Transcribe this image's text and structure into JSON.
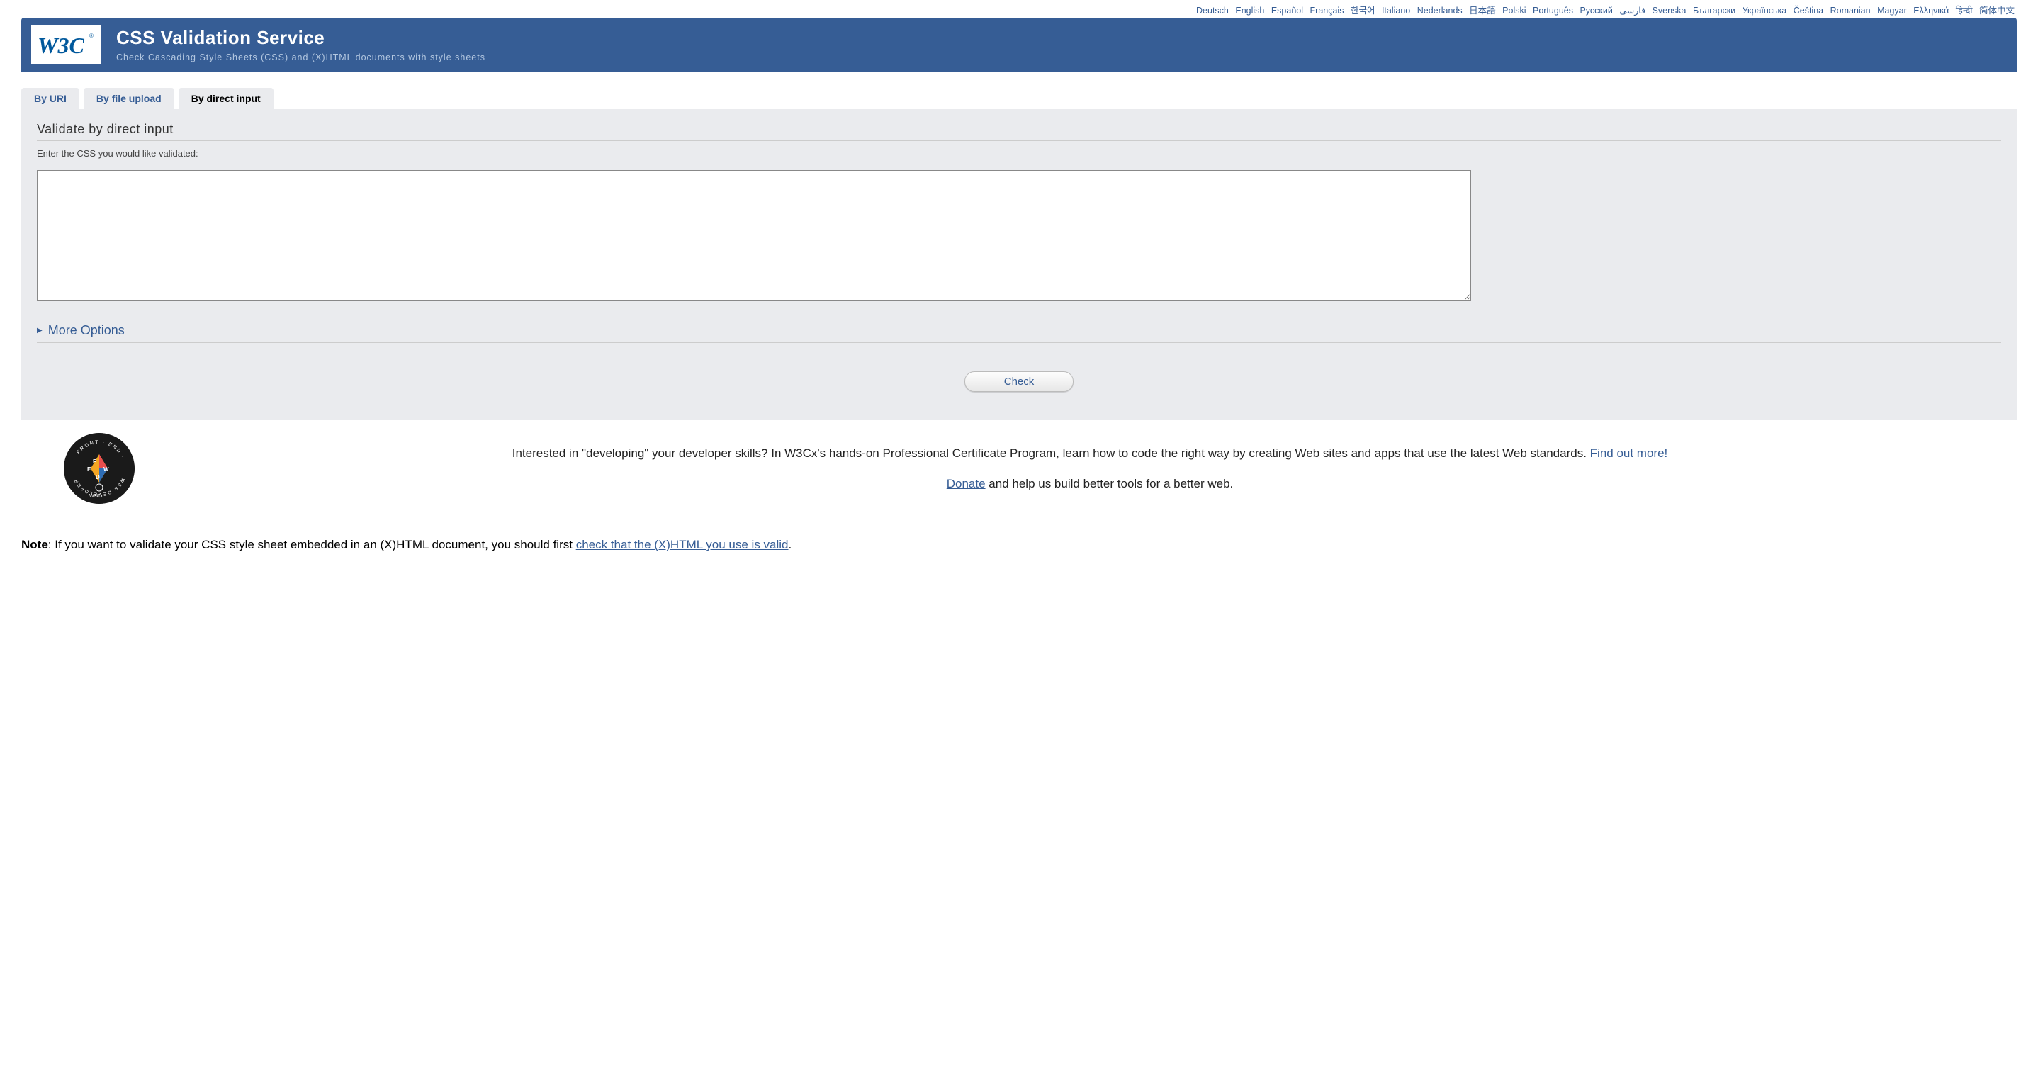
{
  "languages": [
    "Deutsch",
    "English",
    "Español",
    "Français",
    "한국어",
    "Italiano",
    "Nederlands",
    "日本語",
    "Polski",
    "Português",
    "Русский",
    "فارسی",
    "Svenska",
    "Български",
    "Українська",
    "Čeština",
    "Romanian",
    "Magyar",
    "Ελληνικά",
    "हिन्दी",
    "简体中文"
  ],
  "banner": {
    "title": "CSS Validation Service",
    "subtitle": "Check Cascading Style Sheets (CSS) and (X)HTML documents with style sheets",
    "logo_text": "W3C"
  },
  "tabs": {
    "by_uri": "By URI",
    "by_file": "By file upload",
    "by_direct": "By direct input"
  },
  "form": {
    "heading": "Validate by direct input",
    "instruction": "Enter the CSS you would like validated:",
    "textarea_value": "",
    "more_options": "More Options",
    "submit": "Check"
  },
  "promo": {
    "text_before": "Interested in \"developing\" your developer skills? In W3Cx's hands-on Professional Certificate Program, learn how to code the right way by creating Web sites and apps that use the latest Web standards. ",
    "find_out": "Find out more!",
    "donate": "Donate",
    "donate_after": " and help us build better tools for a better web."
  },
  "note": {
    "prefix": "Note",
    "body": ": If you want to validate your CSS style sheet embedded in an (X)HTML document, you should first ",
    "link": "check that the (X)HTML you use is valid",
    "suffix": "."
  }
}
